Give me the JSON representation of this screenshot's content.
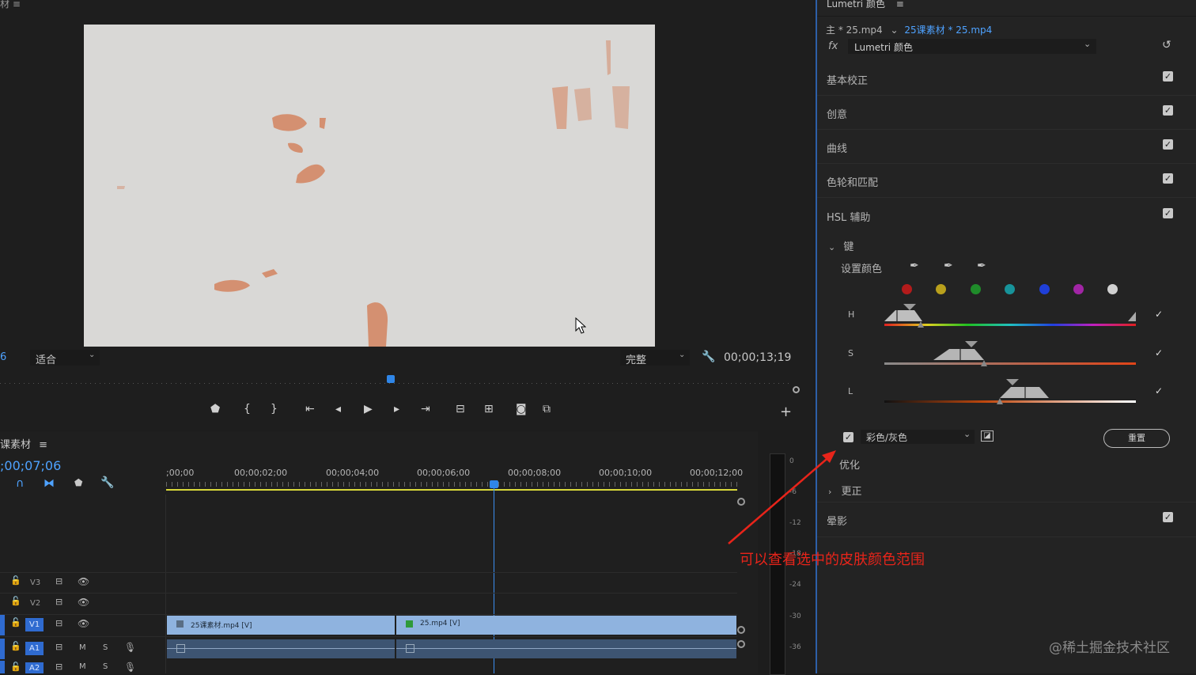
{
  "program_monitor": {
    "fit_label": "适合",
    "quality_label": "完整",
    "timecode": "00;00;13;19",
    "left_stub": "6"
  },
  "program_controls": [
    "marker",
    "in",
    "out",
    "go-in",
    "step-back",
    "play",
    "step-fwd",
    "go-out",
    "lift",
    "extract",
    "export-frame",
    "compare"
  ],
  "timeline": {
    "tab_label": "课素材",
    "timecode": ";00;07;06",
    "ruler_labels": [
      ";00;00",
      "00;00;02;00",
      "00;00;04;00",
      "00;00;06;00",
      "00;00;08;00",
      "00;00;10;00",
      "00;00;12;00"
    ],
    "tracks": [
      {
        "name": "V3"
      },
      {
        "name": "V2"
      },
      {
        "name": "V1"
      },
      {
        "name": "A1",
        "m": "M",
        "s": "S"
      },
      {
        "name": "A2",
        "m": "M",
        "s": "S"
      }
    ],
    "clip1_label": "25课素材.mp4 [V]",
    "clip2_label": "25.mp4 [V]"
  },
  "meter_scale": [
    "0",
    "-6",
    "-12",
    "-18",
    "-24",
    "-30",
    "-36"
  ],
  "lumetri": {
    "panel_title": "Lumetri 颜色",
    "source_label": "主 * 25.mp4",
    "sequence_label": "25课素材 * 25.mp4",
    "fx_label": "fx",
    "effect_name": "Lumetri 颜色",
    "sections": [
      "基本校正",
      "创意",
      "曲线",
      "色轮和匹配",
      "HSL 辅助"
    ],
    "key_label": "键",
    "set_color_label": "设置颜色",
    "swatch_colors": [
      "#b31b1b",
      "#b9a01c",
      "#1f8c2a",
      "#17939a",
      "#1f3fd8",
      "#a125a5",
      "#d0d0d0"
    ],
    "hsl_labels": [
      "H",
      "S",
      "L"
    ],
    "display_mode": "彩色/灰色",
    "reset_label": "重置",
    "refine_label": "优化",
    "correction_label": "更正",
    "vignette_label": "晕影"
  },
  "annotation": "可以查看选中的皮肤颜色范围",
  "watermark": "@稀土掘金技术社区"
}
